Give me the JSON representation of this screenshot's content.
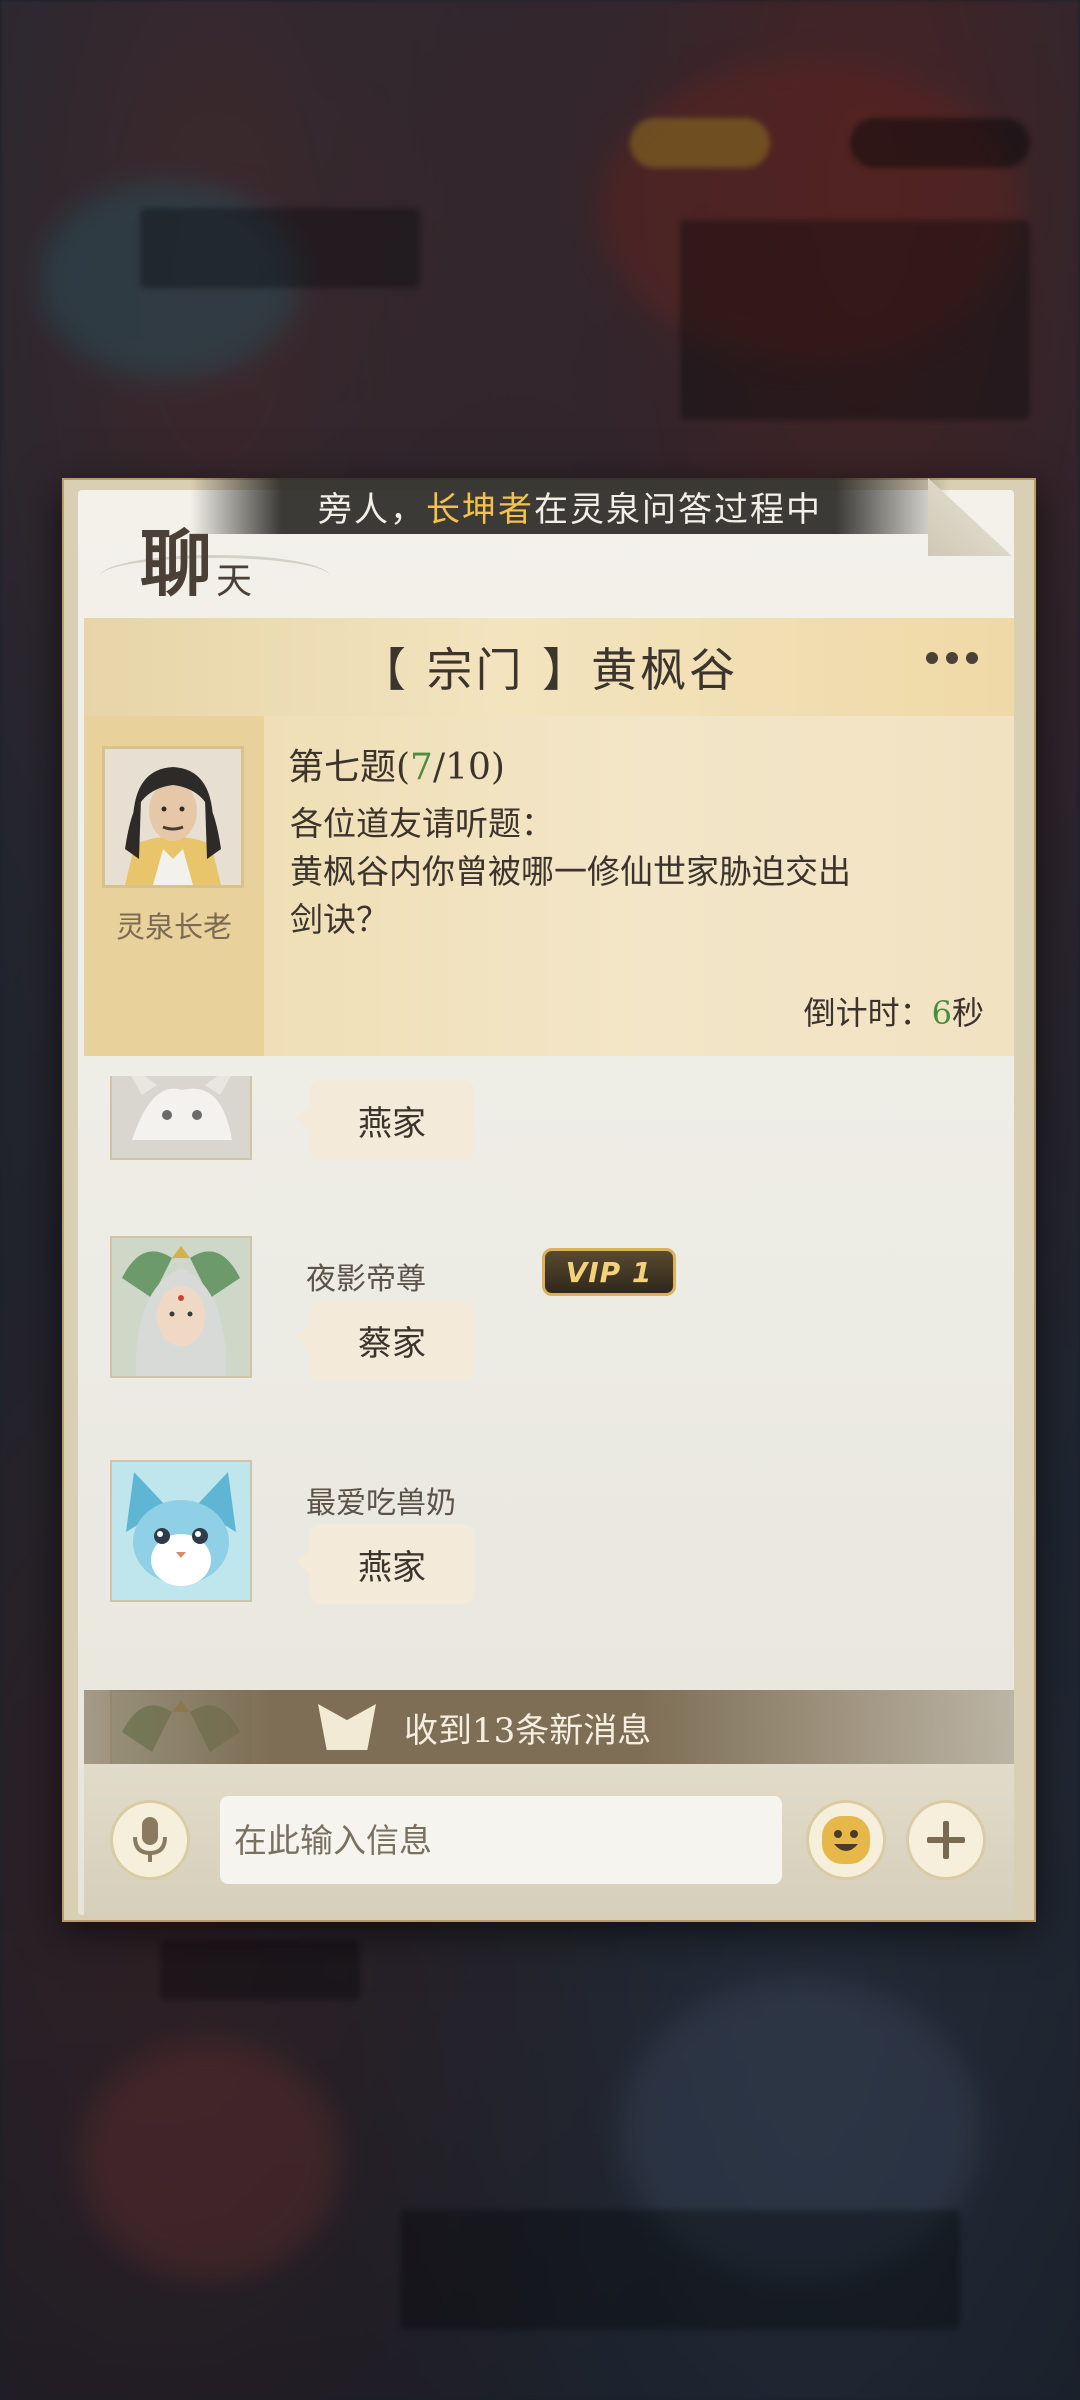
{
  "banner": {
    "prefix": "旁人，",
    "player": "长坤者",
    "suffix": "在灵泉问答过程中"
  },
  "header": {
    "title_big": "聊",
    "title_small": "天"
  },
  "channel": {
    "name": "【 宗门 】黄枫谷"
  },
  "quiz": {
    "npc_name": "灵泉长老",
    "title_prefix": "第七题(",
    "current": "7",
    "total": "/10)",
    "line1": "各位道友请听题：",
    "line2": "黄枫谷内你曾被哪一修仙世家胁迫交出",
    "line3": "剑诀？",
    "countdown_label": "倒计时：",
    "countdown_value": "6",
    "countdown_unit": "秒"
  },
  "messages": [
    {
      "name": "",
      "text": "燕家"
    },
    {
      "name": "夜影帝尊",
      "vip": "VIP 1",
      "text": "蔡家"
    },
    {
      "name": "最爱吃兽奶",
      "text": "燕家"
    }
  ],
  "new_messages": {
    "label": "收到13条新消息"
  },
  "input": {
    "placeholder": "在此输入信息"
  }
}
